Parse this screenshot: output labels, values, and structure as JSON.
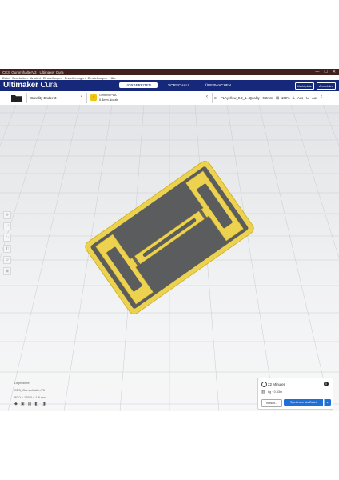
{
  "window": {
    "title": "CE3_GummihalterV3 - Ultimaker Cura",
    "controls": [
      "—",
      "☐",
      "✕"
    ]
  },
  "menubar": [
    "Datei",
    "Bearbeiten",
    "Ansicht",
    "Einstellungen",
    "Erweiterungen",
    "Einstellungen",
    "Hilfe"
  ],
  "header": {
    "brand_bold": "Ultimaker",
    "brand_light": "Cura",
    "stages": [
      "VORBEREITEN",
      "VORSCHAU",
      "ÜBERWACHEN"
    ],
    "active_stage": "VORBEREITEN",
    "right_buttons": [
      "Marktplatz",
      "Anmelden"
    ]
  },
  "toolbar": {
    "printer": "Creality Ender-3",
    "material_badge": "1",
    "material_name": "Generic PLA",
    "nozzle": "0.4mm Nozzle",
    "profile": "PLAyellow_0.2_1...Quality - 0.2mm",
    "infill": "100%",
    "support": "Aus",
    "adhesion": "Aus"
  },
  "left_tools": [
    "move-tool",
    "scale-tool",
    "rotate-tool",
    "mirror-tool",
    "per-model-settings-tool",
    "support-blocker-tool"
  ],
  "object_info": {
    "list_label": "Objektliste",
    "object_name": "CE3_GummihalterV3",
    "dimensions": "80.0 x 165.0 x 1.8 mm"
  },
  "print_panel": {
    "time": "22 Minuten",
    "material_usage": "6g · 0.83m",
    "preview_button": "Vorsch...",
    "save_button": "Speichern als Datei"
  },
  "colors": {
    "header_bg": "#16287a",
    "titlebar_bg": "#41211e",
    "model_yellow": "#ecd24e",
    "infill_gray": "#5b5c5e",
    "save_button": "#1f6fd8"
  }
}
